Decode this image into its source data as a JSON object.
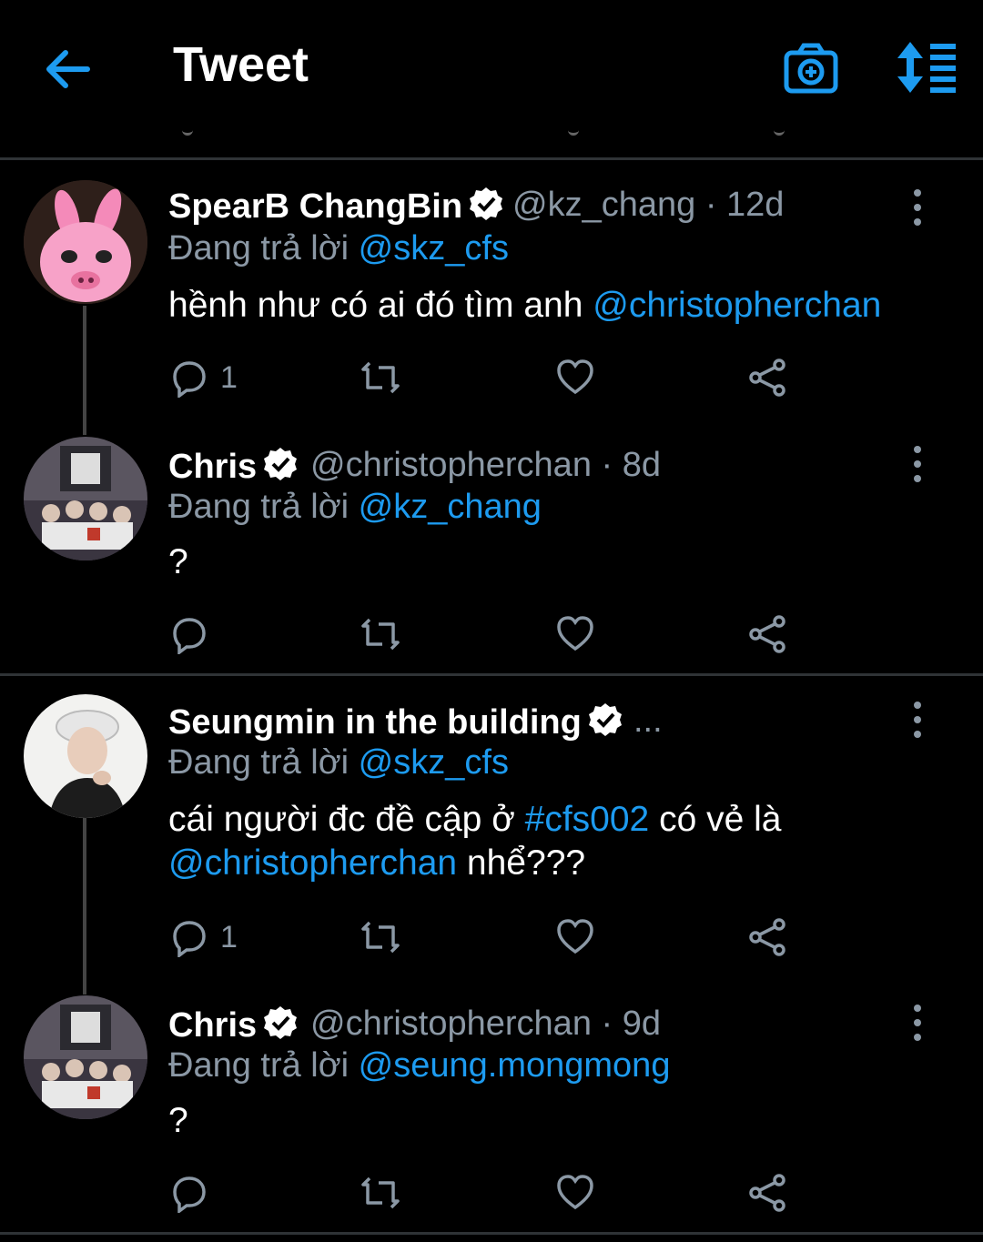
{
  "header": {
    "title": "Tweet"
  },
  "replying_prefix": "Đang trả lời",
  "tweets": [
    {
      "name": "SpearB ChangBin",
      "handle": "@kz_chang",
      "time": "· 12d",
      "reply_to": "@skz_cfs",
      "text_plain": "hềnh như có ai đó tìm anh ",
      "text_mention": "@christopherchan",
      "reply_count": "1"
    },
    {
      "name": "Chris",
      "handle": "@christopherchan",
      "time": "· 8d",
      "reply_to": "@kz_chang",
      "text": "?",
      "reply_count": ""
    },
    {
      "name": "Seungmin in the building",
      "handle": "...",
      "time": "",
      "reply_to": "@skz_cfs",
      "text_line1_a": "cái người đc đề cập ở ",
      "text_hashtag": "#cfs002",
      "text_line1_b": " có vẻ là",
      "text_line2_mention": "@christopherchan",
      "text_line2_b": " nhể???",
      "reply_count": "1"
    },
    {
      "name": "Chris",
      "handle": "@christopherchan",
      "time": "· 9d",
      "reply_to": "@seung.mongmong",
      "text": "?",
      "reply_count": ""
    }
  ],
  "colors": {
    "accent": "#1d9bf0",
    "secondary": "#8b98a5",
    "background": "#000000"
  }
}
